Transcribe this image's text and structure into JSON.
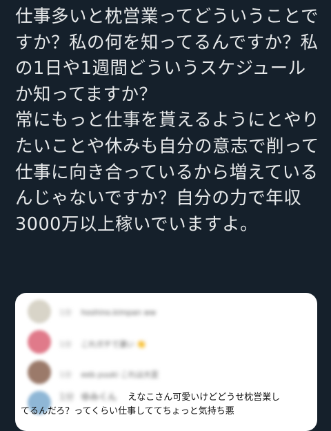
{
  "tweet": {
    "text": "仕事多いと枕営業ってどういうことですか？私の何を知ってるんですか？私の1日や1週間どういうスケジュールか知ってますか？\n常にもっと仕事を貰えるようにとやりたいことや休みも自分の意志で削って仕事に向き合っているから増えているんじゃないですか？自分の力で年収3000万以上稼いでいますよ。"
  },
  "comments": [
    {
      "time": "1分",
      "user": "hoshino.kimpan",
      "text": "ww",
      "avatar_color": "#d8d4c8"
    },
    {
      "time": "1分",
      "user": "これガチで凄い",
      "text": "👏",
      "avatar_color": "#e07a8a"
    },
    {
      "time": "1分",
      "user": "eeb.yuuki",
      "text": "これは大変",
      "avatar_color": "#9b7a6a"
    },
    {
      "time": "1分",
      "user": "ゆみくん",
      "body_line1": "えなこさん可愛いけどどうせ枕営業し",
      "body_line2": "てるんだろ？ってくらい仕事しててちょっと気持ち悪",
      "avatar_color": "#8fb7d6"
    }
  ]
}
